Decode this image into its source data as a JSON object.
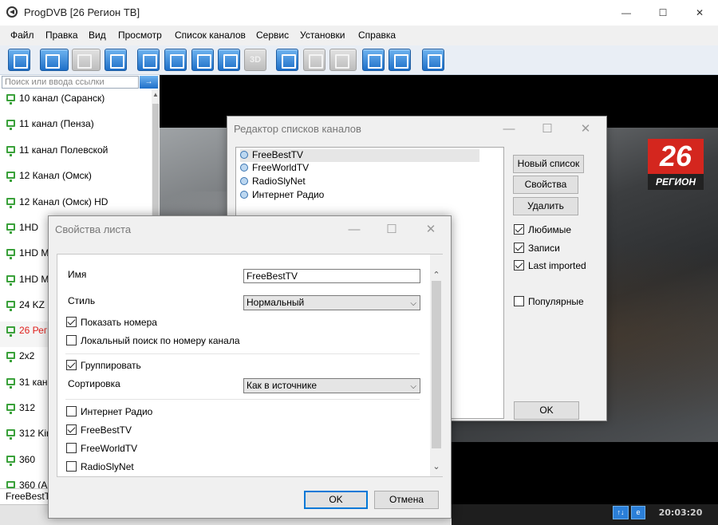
{
  "window": {
    "title": "ProgDVB [26 Регион ТВ]",
    "controls": {
      "minimize": "—",
      "maximize": "☐",
      "close": "✕"
    }
  },
  "menu": [
    "Файл",
    "Правка",
    "Вид",
    "Просмотр",
    "Список каналов",
    "Сервис",
    "Установки",
    "Справка"
  ],
  "toolbar": {
    "three_d_label": "3D"
  },
  "search": {
    "placeholder": "Поиск или ввода ссылки",
    "go_icon": "→"
  },
  "channels": [
    "10 канал (Саранск)",
    "11 канал (Пенза)",
    "11 канал Полевской",
    "12 Канал (Омск)",
    "12 Канал (Омск) HD",
    "1HD",
    "1HD M",
    "1HD M",
    "24 KZ",
    "26 Реги",
    "2x2",
    "31 кан",
    "312",
    "312 Kir",
    "360",
    "360 (А"
  ],
  "selected_channel_index": 9,
  "status_left": "FreeBestT",
  "video": {
    "logo_number": "26",
    "logo_text": "РЕГИОН",
    "clock": "20:03:20"
  },
  "editor": {
    "title": "Редактор списков каналов",
    "lists": [
      "FreeBestTV",
      "FreeWorldTV",
      "RadioSlyNet",
      "Интернет Радио"
    ],
    "selected_index": 0,
    "buttons": {
      "new": "Новый список",
      "props": "Свойства",
      "delete": "Удалить",
      "ok": "OK"
    },
    "checkboxes": [
      {
        "label": "Любимые",
        "checked": true
      },
      {
        "label": "Записи",
        "checked": true
      },
      {
        "label": "Last imported",
        "checked": true
      },
      {
        "label": "Популярные",
        "checked": false
      }
    ]
  },
  "props": {
    "title": "Свойства листа",
    "name_label": "Имя",
    "name_value": "FreeBestTV",
    "style_label": "Стиль",
    "style_value": "Нормальный",
    "show_numbers": {
      "label": "Показать номера",
      "checked": true
    },
    "local_search": {
      "label": "Локальный поиск по номеру канала",
      "checked": false
    },
    "group": {
      "label": "Группировать",
      "checked": true
    },
    "sort_label": "Сортировка",
    "sort_value": "Как в источнике",
    "sources": [
      {
        "label": "Интернет Радио",
        "checked": false
      },
      {
        "label": "FreeBestTV",
        "checked": true
      },
      {
        "label": "FreeWorldTV",
        "checked": false
      },
      {
        "label": "RadioSlyNet",
        "checked": false
      }
    ],
    "ok": "OK",
    "cancel": "Отмена"
  }
}
